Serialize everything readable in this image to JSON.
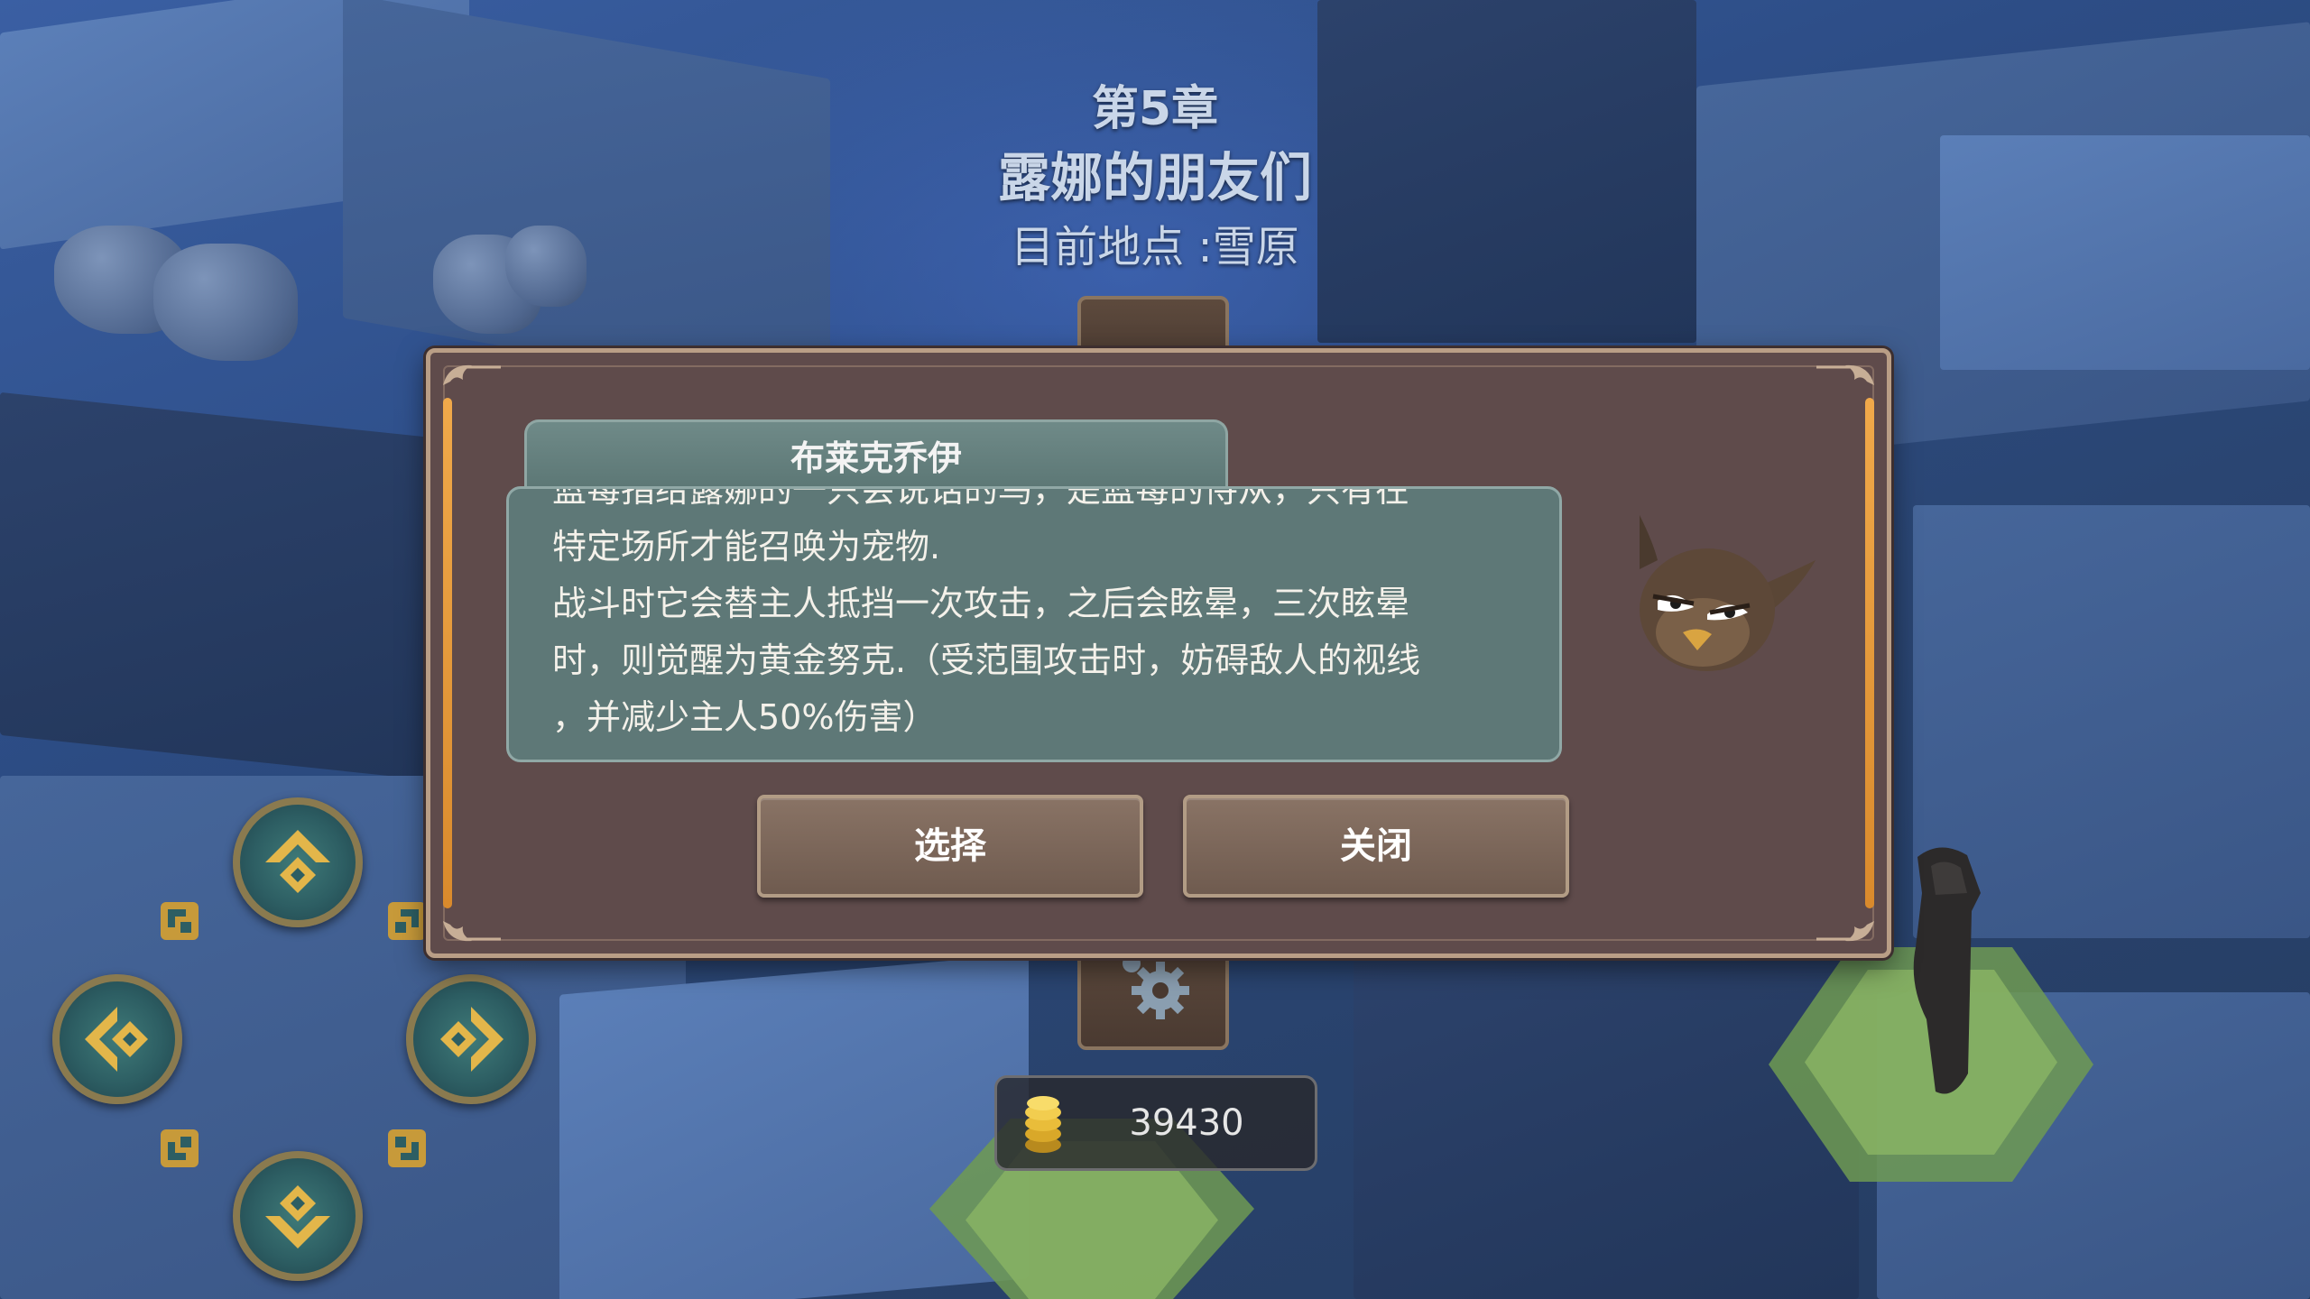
{
  "chapter": {
    "number": "第5章",
    "title": "露娜的朋友们",
    "location": "目前地点 :雪原"
  },
  "dialog": {
    "name": "布莱克乔伊",
    "description": "蓝莓指给露娜的一只会说话的鸟，是蓝莓的侍从，只有在\n特定场所才能召唤为宠物.\n战斗时它会替主人抵挡一次攻击，之后会眩晕，三次眩晕\n时，则觉醒为黄金努克.（受范围攻击时，妨碍敌人的视线\n，并减少主人50%伤害）",
    "select_label": "选择",
    "close_label": "关闭",
    "portrait_icon": "bird-owl-icon"
  },
  "currency": {
    "icon": "gold-coin-icon",
    "amount": "39430"
  },
  "dpad": {
    "up_icon": "arrow-up-icon",
    "down_icon": "arrow-down-icon",
    "left_icon": "arrow-left-icon",
    "right_icon": "arrow-right-icon"
  },
  "colors": {
    "dialog_bg": "#5f4b4b",
    "panel_teal": "#5e7877",
    "accent_orange": "#f0a94a",
    "dpad_gold": "#8a7a4f"
  }
}
